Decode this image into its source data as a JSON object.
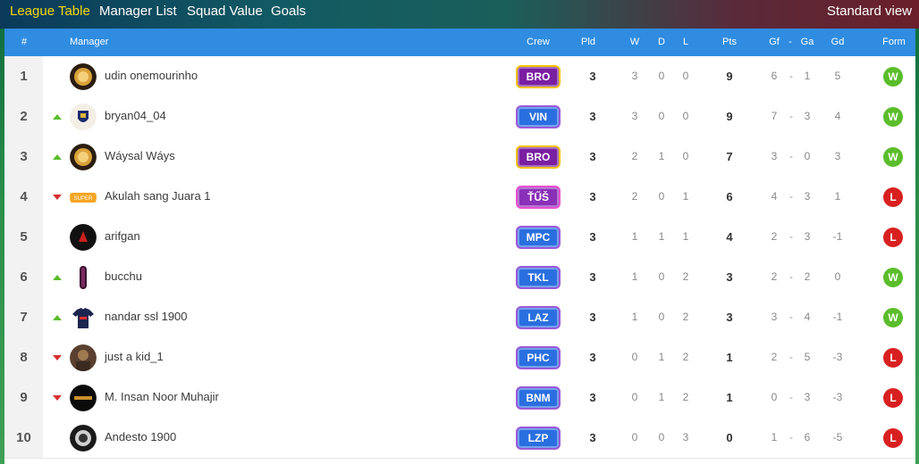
{
  "nav": {
    "tabs": [
      {
        "label": "League Table",
        "active": true
      },
      {
        "label": "Manager List",
        "active": false
      },
      {
        "label": "Squad Value",
        "active": false
      },
      {
        "label": "Goals",
        "active": false
      }
    ],
    "view_label": "Standard view"
  },
  "table": {
    "headers": {
      "rank": "#",
      "manager": "Manager",
      "crew": "Crew",
      "pld": "Pld",
      "w": "W",
      "d": "D",
      "l": "L",
      "pts": "Pts",
      "gf": "Gf",
      "sep": "-",
      "ga": "Ga",
      "gd": "Gd",
      "form": "Form"
    },
    "rows": [
      {
        "rank": "1",
        "movement": "none",
        "avatar": "gold-badge-icon",
        "manager": "udin onemourinho",
        "crew": "BRO",
        "crew_style": "gold",
        "pld": "3",
        "w": "3",
        "d": "0",
        "l": "0",
        "pts": "9",
        "gf": "6",
        "ga": "1",
        "gd": "5",
        "form": "W"
      },
      {
        "rank": "2",
        "movement": "up",
        "avatar": "crest-icon",
        "manager": "bryan04_04",
        "crew": "VIN",
        "crew_style": "blue",
        "pld": "3",
        "w": "3",
        "d": "0",
        "l": "0",
        "pts": "9",
        "gf": "7",
        "ga": "3",
        "gd": "4",
        "form": "W"
      },
      {
        "rank": "3",
        "movement": "up",
        "avatar": "gold-badge-icon",
        "manager": "Wáysal Wáys",
        "crew": "BRO",
        "crew_style": "gold",
        "pld": "3",
        "w": "2",
        "d": "1",
        "l": "0",
        "pts": "7",
        "gf": "3",
        "ga": "0",
        "gd": "3",
        "form": "W"
      },
      {
        "rank": "4",
        "movement": "down",
        "avatar": "super-tag-icon",
        "manager": "Akulah sang Juara 1",
        "crew": "ŤŰŠ",
        "crew_style": "purple",
        "pld": "3",
        "w": "2",
        "d": "0",
        "l": "1",
        "pts": "6",
        "gf": "4",
        "ga": "3",
        "gd": "1",
        "form": "L"
      },
      {
        "rank": "5",
        "movement": "none",
        "avatar": "red-logo-icon",
        "manager": "arifgan",
        "crew": "MPC",
        "crew_style": "blue",
        "pld": "3",
        "w": "1",
        "d": "1",
        "l": "1",
        "pts": "4",
        "gf": "2",
        "ga": "3",
        "gd": "-1",
        "form": "L"
      },
      {
        "rank": "6",
        "movement": "up",
        "avatar": "bar-icon",
        "manager": "bucchu",
        "crew": "TKL",
        "crew_style": "blue",
        "pld": "3",
        "w": "1",
        "d": "0",
        "l": "2",
        "pts": "3",
        "gf": "2",
        "ga": "2",
        "gd": "0",
        "form": "W"
      },
      {
        "rank": "7",
        "movement": "up",
        "avatar": "shirt-icon",
        "manager": "nandar ssl 1900",
        "crew": "LAZ",
        "crew_style": "blue",
        "pld": "3",
        "w": "1",
        "d": "0",
        "l": "2",
        "pts": "3",
        "gf": "3",
        "ga": "4",
        "gd": "-1",
        "form": "W"
      },
      {
        "rank": "8",
        "movement": "down",
        "avatar": "photo-avatar-icon",
        "manager": "just a kid_1",
        "crew": "PHC",
        "crew_style": "blue",
        "pld": "3",
        "w": "0",
        "d": "1",
        "l": "2",
        "pts": "1",
        "gf": "2",
        "ga": "5",
        "gd": "-3",
        "form": "L"
      },
      {
        "rank": "9",
        "movement": "down",
        "avatar": "text-logo-icon",
        "manager": "M. Insan Noor Muhajir",
        "crew": "BNM",
        "crew_style": "blue",
        "pld": "3",
        "w": "0",
        "d": "1",
        "l": "2",
        "pts": "1",
        "gf": "0",
        "ga": "3",
        "gd": "-3",
        "form": "L"
      },
      {
        "rank": "10",
        "movement": "none",
        "avatar": "dark-logo-icon",
        "manager": "Andesto 1900",
        "crew": "LZP",
        "crew_style": "blue",
        "pld": "3",
        "w": "0",
        "d": "0",
        "l": "3",
        "pts": "0",
        "gf": "1",
        "ga": "6",
        "gd": "-5",
        "form": "L"
      }
    ]
  },
  "colors": {
    "header_bg": "#2f8ce0",
    "active_tab": "#f5d90a",
    "form_win": "#5bbd2b",
    "form_loss": "#d92020",
    "arrow_up": "#5bbd2b",
    "arrow_down": "#d83030"
  }
}
